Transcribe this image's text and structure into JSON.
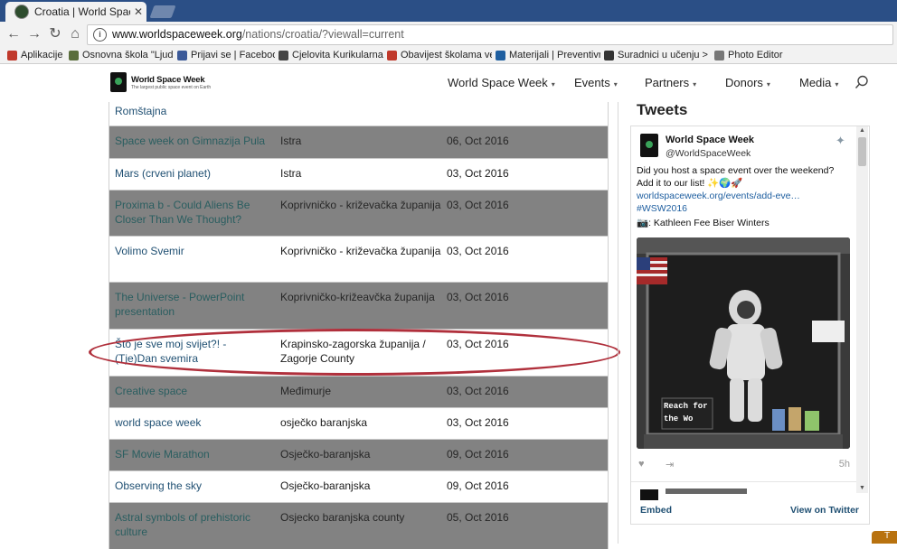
{
  "browser": {
    "tab_title": "Croatia | World Space We",
    "tab_close": "✕",
    "url_host": "www.worldspaceweek.org",
    "url_path": "/nations/croatia/?viewall=current",
    "bookmarks": [
      {
        "label": "Aplikacije",
        "color": "#c0392b"
      },
      {
        "label": "Osnovna škola \"Ljude",
        "color": "#5a6e3c"
      },
      {
        "label": "Prijavi se | Facebook",
        "color": "#3b5998"
      },
      {
        "label": "Cjelovita Kurikularna F",
        "color": "#444444"
      },
      {
        "label": "Obavijest školama vez",
        "color": "#c0392b"
      },
      {
        "label": "Materijali | Preventivn",
        "color": "#1f5fa0"
      },
      {
        "label": "Suradnici u učenju > S",
        "color": "#333333"
      },
      {
        "label": "Photo Editor",
        "color": "#777777"
      }
    ]
  },
  "site": {
    "logo_title": "World Space Week",
    "logo_subtitle": "The largest public space event on Earth",
    "nav": [
      {
        "label": "World Space Week"
      },
      {
        "label": "Events"
      },
      {
        "label": "Partners"
      },
      {
        "label": "Donors"
      },
      {
        "label": "Media"
      }
    ]
  },
  "events": {
    "first_row_partial": "Romštajna",
    "rows": [
      {
        "name": "Space week on Gimnazija Pula",
        "region": "Istra",
        "date": "06, Oct 2016",
        "shade": "shaded"
      },
      {
        "name": "Mars (crveni planet)",
        "region": "Istra",
        "date": "03, Oct 2016",
        "shade": "white"
      },
      {
        "name": "Proxima b - Could Aliens Be Closer Than We Thought?",
        "region": "Koprivničko - križevačka županija",
        "date": "03, Oct 2016",
        "shade": "shaded"
      },
      {
        "name": "Volimo Svemir",
        "region": "Koprivničko - križevačka županija",
        "date": "03, Oct 2016",
        "shade": "white"
      },
      {
        "name": "The Universe - PowerPoint presentation",
        "region": "Koprivničko-križeavčka županija",
        "date": "03, Oct 2016",
        "shade": "shaded"
      },
      {
        "name": "Što je sve moj svijet?! - (Tje)Dan svemira",
        "region": "Krapinsko-zagorska županija / Zagorje County",
        "date": "03, Oct 2016",
        "shade": "white"
      },
      {
        "name": "Creative space",
        "region": "Međimurje",
        "date": "03, Oct 2016",
        "shade": "shaded"
      },
      {
        "name": "world space week",
        "region": "osječko baranjska",
        "date": "03, Oct 2016",
        "shade": "white"
      },
      {
        "name": "SF Movie Marathon",
        "region": "Osječko-baranjska",
        "date": "09, Oct 2016",
        "shade": "shaded"
      },
      {
        "name": "Observing the sky",
        "region": "Osječko-baranjska",
        "date": "09, Oct 2016",
        "shade": "white"
      },
      {
        "name": "Astral symbols of prehistoric culture",
        "region": "Osjecko baranjska county",
        "date": "05, Oct 2016",
        "shade": "shaded"
      }
    ]
  },
  "tweets": {
    "heading": "Tweets",
    "author_name": "World Space Week",
    "author_handle": "@WorldSpaceWeek",
    "text_main": "Did you host a space event over the weekend? Add it to our list! ✨🌍🚀 ",
    "text_link": "worldspaceweek.org/events/add-eve…",
    "text_hashtag": " #WSW2016",
    "photo_credit": "📷: Kathleen Fee Biser Winters",
    "photo_sign": "Reach for the Wo",
    "time": "5h",
    "embed_label": "Embed",
    "view_label": "View on Twitter"
  },
  "corner_tab_label": "T"
}
